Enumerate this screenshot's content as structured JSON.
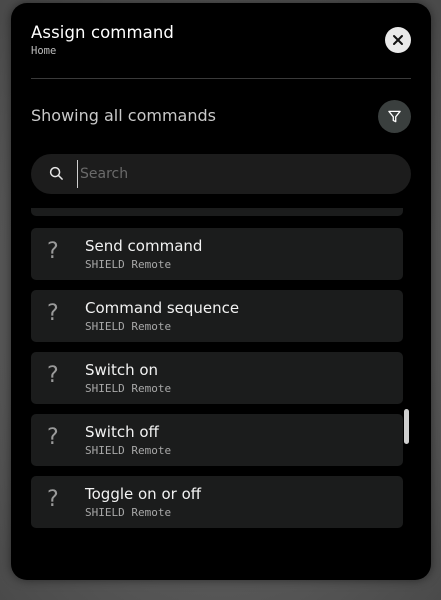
{
  "modal": {
    "title": "Assign command",
    "breadcrumb": "Home",
    "close_icon": "close-icon",
    "filter_status": "Showing all commands",
    "filter_icon": "filter-icon"
  },
  "search": {
    "placeholder": "Search",
    "value": "",
    "icon": "search-icon"
  },
  "commands": [
    {
      "name": "",
      "device": "",
      "icon": "question-icon"
    },
    {
      "name": "Send command",
      "device": "SHIELD Remote",
      "icon": "question-icon"
    },
    {
      "name": "Command sequence",
      "device": "SHIELD Remote",
      "icon": "question-icon"
    },
    {
      "name": "Switch on",
      "device": "SHIELD Remote",
      "icon": "question-icon"
    },
    {
      "name": "Switch off",
      "device": "SHIELD Remote",
      "icon": "question-icon"
    },
    {
      "name": "Toggle on or off",
      "device": "SHIELD Remote",
      "icon": "question-icon"
    }
  ],
  "colors": {
    "modal_bg": "#000000",
    "item_bg": "#1b1c1c",
    "search_bg": "#1c1c1c",
    "filter_bg": "#3a3f3e"
  }
}
